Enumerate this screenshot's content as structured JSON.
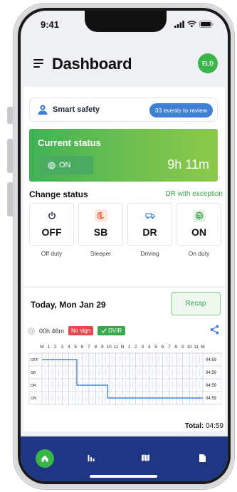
{
  "status_bar": {
    "time": "9:41"
  },
  "header": {
    "title": "Dashboard",
    "badge": "ELD"
  },
  "safety": {
    "label": "Smart safety",
    "events_button": "33 events to review"
  },
  "current_status": {
    "title": "Current status",
    "status_button": "ON",
    "duration": "9h 11m"
  },
  "change_status": {
    "title": "Change status",
    "exception_link": "DR with exception",
    "items": [
      {
        "code": "OFF",
        "desc": "Off duty",
        "icon": "power-icon",
        "color": "#1b2236",
        "bg": "#ffffff"
      },
      {
        "code": "SB",
        "desc": "Sleeper",
        "icon": "sleeper-icon",
        "color": "#e8592b",
        "bg": "#fde7df"
      },
      {
        "code": "DR",
        "desc": "Driving",
        "icon": "truck-icon",
        "color": "#3f7fd4",
        "bg": "#ffffff"
      },
      {
        "code": "ON",
        "desc": "On duty",
        "icon": "target-icon",
        "color": "#3aa14e",
        "bg": "#e5f5e7"
      }
    ]
  },
  "log": {
    "date": "Today, Mon Jan 29",
    "recap_button": "Recap",
    "elapsed": "00h 46m",
    "no_sign_badge": "No sign",
    "dvir_badge": "DVIR",
    "hours_labels": [
      "M",
      "1",
      "2",
      "3",
      "4",
      "5",
      "6",
      "7",
      "8",
      "9",
      "10",
      "11",
      "N",
      "1",
      "2",
      "3",
      "4",
      "5",
      "6",
      "7",
      "8",
      "9",
      "10",
      "11",
      "M"
    ],
    "rows": [
      {
        "label": "OFF",
        "total": "04:59"
      },
      {
        "label": "SB",
        "total": "04:59"
      },
      {
        "label": "DR",
        "total": "04:59"
      },
      {
        "label": "ON",
        "total": "04:59"
      }
    ],
    "total_label": "Total:",
    "total_value": "04:59"
  },
  "tabs": [
    {
      "name": "home",
      "icon": "home-icon"
    },
    {
      "name": "stats",
      "icon": "bar-chart-icon"
    },
    {
      "name": "map",
      "icon": "map-icon"
    },
    {
      "name": "documents",
      "icon": "document-icon"
    }
  ],
  "colors": {
    "accent_blue": "#3f7fd4",
    "green": "#3aa14e",
    "tab_bar": "#1f3685",
    "red": "#e5484d"
  }
}
